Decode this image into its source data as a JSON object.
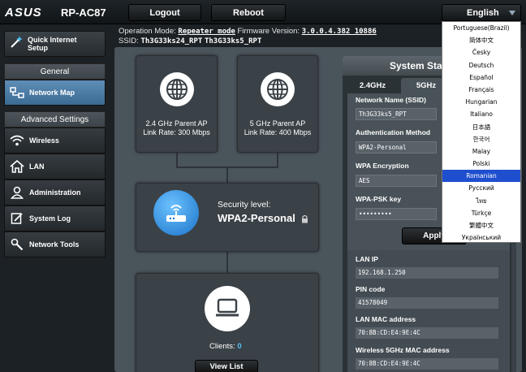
{
  "header": {
    "brand": "ASUS",
    "model": "RP-AC87",
    "logout_label": "Logout",
    "reboot_label": "Reboot",
    "language_selected": "English",
    "operation_mode_label": "Operation Mode:",
    "operation_mode_value": "Repeater mode",
    "firmware_label": "Firmware Version:",
    "firmware_value": "3.0.0.4.382_10886",
    "ssid_label": "SSID:",
    "ssid_1": "Th3G33ks24_RPT",
    "ssid_2": "Th3G33ks5_RPT"
  },
  "language_options": [
    "Portuguese(Brazil)",
    "简体中文",
    "Česky",
    "Deutsch",
    "Español",
    "Français",
    "Hungarian",
    "Italiano",
    "日本語",
    "한국어",
    "Malay",
    "Polski",
    "Romanian",
    "Русский",
    "ไทย",
    "Türkçe",
    "繁體中文",
    "Український"
  ],
  "language_highlighted": "Romanian",
  "sidebar": {
    "quick_setup_line1": "Quick Internet",
    "quick_setup_line2": "Setup",
    "general_header": "General",
    "advanced_header": "Advanced Settings",
    "items": [
      {
        "label": "Network Map",
        "icon": "network-map-icon"
      },
      {
        "label": "Wireless",
        "icon": "wifi-icon"
      },
      {
        "label": "LAN",
        "icon": "home-icon"
      },
      {
        "label": "Administration",
        "icon": "user-icon"
      },
      {
        "label": "System Log",
        "icon": "log-icon"
      },
      {
        "label": "Network Tools",
        "icon": "tools-icon"
      }
    ]
  },
  "map": {
    "ap24_line1": "2.4 GHz Parent AP",
    "ap24_line2": "Link Rate: 300 Mbps",
    "ap5_line1": "5 GHz Parent AP",
    "ap5_line2": "Link Rate: 400 Mbps",
    "security_label": "Security level:",
    "security_value": "WPA2-Personal",
    "clients_label": "Clients:",
    "clients_count": "0",
    "view_list_label": "View List"
  },
  "status": {
    "title": "System Status",
    "tab_24": "2.4GHz",
    "tab_5": "5GHz",
    "ssid_label": "Network Name (SSID)",
    "ssid_value": "Th3G33ks5_RPT",
    "auth_label": "Authentication Method",
    "auth_value": "WPA2-Personal",
    "enc_label": "WPA Encryption",
    "enc_value": "AES",
    "psk_label": "WPA-PSK key",
    "psk_value": "•••••••••",
    "apply_label": "Apply",
    "lan_ip_label": "LAN IP",
    "lan_ip_value": "192.168.1.250",
    "pin_label": "PIN code",
    "pin_value": "41578049",
    "lan_mac_label": "LAN MAC address",
    "lan_mac_value": "70:8B:CD:E4:9E:4C",
    "wl5_mac_label": "Wireless 5GHz MAC address",
    "wl5_mac_value": "70:8B:CD:E4:9E:4C"
  }
}
